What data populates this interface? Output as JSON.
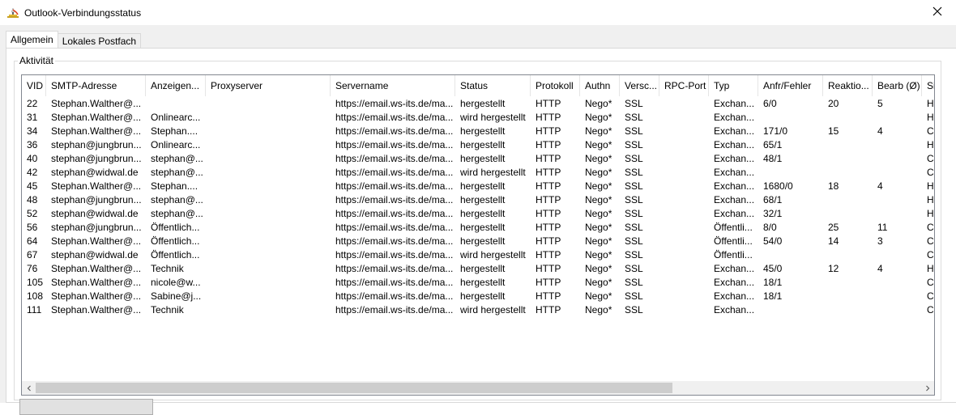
{
  "window": {
    "title": "Outlook-Verbindungsstatus"
  },
  "tabs": [
    {
      "label": "Allgemein",
      "active": true
    },
    {
      "label": "Lokales Postfach",
      "active": false
    }
  ],
  "group": {
    "label": "Aktivität"
  },
  "table": {
    "columns": [
      "VID",
      "SMTP-Adresse",
      "Anzeigen...",
      "Proxyserver",
      "Servername",
      "Status",
      "Protokoll",
      "Authn",
      "Versc...",
      "RPC-Port",
      "Typ",
      "Anfr/Fehler",
      "Reaktio...",
      "Bearb (Ø)",
      "Si"
    ],
    "rows": [
      [
        "22",
        "Stephan.Walther@...",
        "",
        "",
        "https://email.ws-its.de/ma...",
        "hergestellt",
        "HTTP",
        "Nego*",
        "SSL",
        "",
        "Exchan...",
        "6/0",
        "20",
        "5",
        "H"
      ],
      [
        "31",
        "Stephan.Walther@...",
        "Onlinearc...",
        "",
        "https://email.ws-its.de/ma...",
        "wird hergestellt",
        "HTTP",
        "Nego*",
        "SSL",
        "",
        "Exchan...",
        "",
        "",
        "",
        "H"
      ],
      [
        "34",
        "Stephan.Walther@...",
        "Stephan....",
        "",
        "https://email.ws-its.de/ma...",
        "hergestellt",
        "HTTP",
        "Nego*",
        "SSL",
        "",
        "Exchan...",
        "171/0",
        "15",
        "4",
        "C"
      ],
      [
        "36",
        "stephan@jungbrun...",
        "Onlinearc...",
        "",
        "https://email.ws-its.de/ma...",
        "hergestellt",
        "HTTP",
        "Nego*",
        "SSL",
        "",
        "Exchan...",
        "65/1",
        "",
        "",
        "H"
      ],
      [
        "40",
        "stephan@jungbrun...",
        "stephan@...",
        "",
        "https://email.ws-its.de/ma...",
        "hergestellt",
        "HTTP",
        "Nego*",
        "SSL",
        "",
        "Exchan...",
        "48/1",
        "",
        "",
        "C"
      ],
      [
        "42",
        "stephan@widwal.de",
        "stephan@...",
        "",
        "https://email.ws-its.de/ma...",
        "wird hergestellt",
        "HTTP",
        "Nego*",
        "SSL",
        "",
        "Exchan...",
        "",
        "",
        "",
        "C"
      ],
      [
        "45",
        "Stephan.Walther@...",
        "Stephan....",
        "",
        "https://email.ws-its.de/ma...",
        "hergestellt",
        "HTTP",
        "Nego*",
        "SSL",
        "",
        "Exchan...",
        "1680/0",
        "18",
        "4",
        "H"
      ],
      [
        "48",
        "stephan@jungbrun...",
        "stephan@...",
        "",
        "https://email.ws-its.de/ma...",
        "hergestellt",
        "HTTP",
        "Nego*",
        "SSL",
        "",
        "Exchan...",
        "68/1",
        "",
        "",
        "H"
      ],
      [
        "52",
        "stephan@widwal.de",
        "stephan@...",
        "",
        "https://email.ws-its.de/ma...",
        "hergestellt",
        "HTTP",
        "Nego*",
        "SSL",
        "",
        "Exchan...",
        "32/1",
        "",
        "",
        "H"
      ],
      [
        "56",
        "stephan@jungbrun...",
        "Öffentlich...",
        "",
        "https://email.ws-its.de/ma...",
        "hergestellt",
        "HTTP",
        "Nego*",
        "SSL",
        "",
        "Öffentli...",
        "8/0",
        "25",
        "11",
        "C"
      ],
      [
        "64",
        "Stephan.Walther@...",
        "Öffentlich...",
        "",
        "https://email.ws-its.de/ma...",
        "hergestellt",
        "HTTP",
        "Nego*",
        "SSL",
        "",
        "Öffentli...",
        "54/0",
        "14",
        "3",
        "C"
      ],
      [
        "67",
        "stephan@widwal.de",
        "Öffentlich...",
        "",
        "https://email.ws-its.de/ma...",
        "wird hergestellt",
        "HTTP",
        "Nego*",
        "SSL",
        "",
        "Öffentli...",
        "",
        "",
        "",
        "C"
      ],
      [
        "76",
        "Stephan.Walther@...",
        "Technik",
        "",
        "https://email.ws-its.de/ma...",
        "hergestellt",
        "HTTP",
        "Nego*",
        "SSL",
        "",
        "Exchan...",
        "45/0",
        "12",
        "4",
        "H"
      ],
      [
        "105",
        "Stephan.Walther@...",
        "nicole@w...",
        "",
        "https://email.ws-its.de/ma...",
        "hergestellt",
        "HTTP",
        "Nego*",
        "SSL",
        "",
        "Exchan...",
        "18/1",
        "",
        "",
        "C"
      ],
      [
        "108",
        "Stephan.Walther@...",
        "Sabine@j...",
        "",
        "https://email.ws-its.de/ma...",
        "hergestellt",
        "HTTP",
        "Nego*",
        "SSL",
        "",
        "Exchan...",
        "18/1",
        "",
        "",
        "C"
      ],
      [
        "111",
        "Stephan.Walther@...",
        "Technik",
        "",
        "https://email.ws-its.de/ma...",
        "wird hergestellt",
        "HTTP",
        "Nego*",
        "SSL",
        "",
        "Exchan...",
        "",
        "",
        "",
        "C"
      ]
    ]
  },
  "icons": {
    "app": "outlook-connection-icon",
    "close": "close-icon",
    "scroll_left": "chevron-left-icon",
    "scroll_right": "chevron-right-icon"
  }
}
